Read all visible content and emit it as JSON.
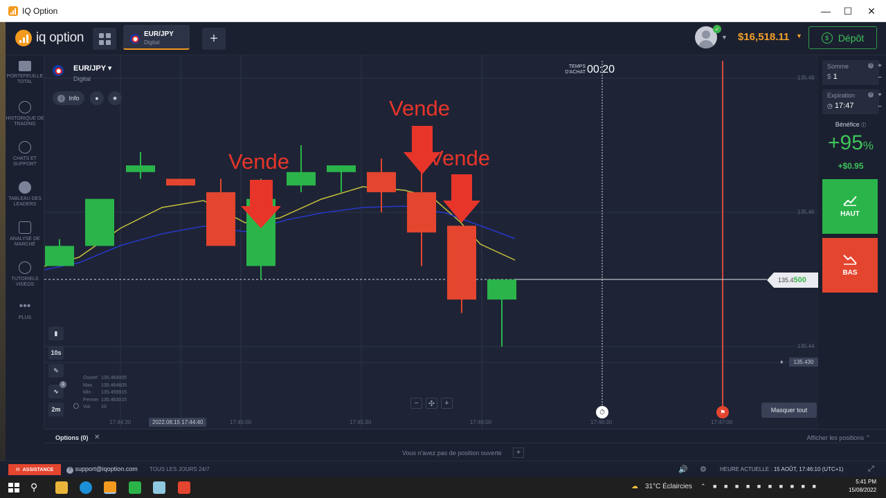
{
  "window": {
    "title": "IQ Option"
  },
  "header": {
    "logo_text": "iq option",
    "asset_tab": {
      "name": "EUR/JPY",
      "type": "Digital"
    },
    "balance": "$16,518.11",
    "deposit_label": "Dépôt"
  },
  "sidebar": {
    "items": [
      {
        "label": "PORTEFEUILLE TOTAL",
        "icon": "briefcase-icon"
      },
      {
        "label": "HISTORIQUE DE TRADING",
        "icon": "history-icon"
      },
      {
        "label": "CHATS ET SUPPORT",
        "icon": "chat-icon"
      },
      {
        "label": "TABLEAU DES LEADERS",
        "icon": "leaderboard-icon"
      },
      {
        "label": "ANALYSE DE MARCHÉ",
        "icon": "market-analysis-icon"
      },
      {
        "label": "TUTORIELS VIDÉOS",
        "icon": "play-icon"
      },
      {
        "label": "PLUS",
        "icon": "more-icon"
      }
    ]
  },
  "chart_header": {
    "asset": "EUR/JPY",
    "type": "Digital",
    "info_label": "Info"
  },
  "timer": {
    "label": "TEMPS D'ACHAT",
    "value": "00:20"
  },
  "annotations": [
    "Vende",
    "Vende",
    "Vende"
  ],
  "tools": {
    "interval": "10s",
    "timeframe": "2m",
    "indicator_count": "1"
  },
  "ohlc": {
    "labels": [
      "Ouvert",
      "Max",
      "Min",
      "Fermer",
      "Vol."
    ],
    "values": [
      "135.464005",
      "135.464605",
      "135.459915",
      "135.463015",
      "10"
    ]
  },
  "price_tag": {
    "prefix": "135.4",
    "suffix": "500"
  },
  "alarm_tag": "135.430",
  "masquer_label": "Masquer tout",
  "right_panel": {
    "amount": {
      "label": "Somme",
      "currency": "$",
      "value": "1"
    },
    "expiration": {
      "label": "Expiration",
      "value": "17:47"
    },
    "benefit_label": "Bénéfice",
    "benefit_percent": "+95",
    "benefit_percent_sign": "%",
    "benefit_amount": "+$0.95",
    "up_label": "HAUT",
    "down_label": "BAS"
  },
  "options_bar": {
    "tab_label": "Options (0)",
    "show_positions": "Afficher les positions",
    "empty_text": "Vous n'avez pas de position ouverte"
  },
  "footer": {
    "assistance": "ASSISTANCE",
    "support_email": "support@iqoption.com",
    "hours": "TOUS LES JOURS 24/7",
    "time_label": "HEURE ACTUELLE :",
    "time_value": "15 AOÛT, 17:46:10 (UTC+1)"
  },
  "taskbar": {
    "weather": "31°C  Éclaircies",
    "time": "5:41 PM",
    "date": "15/08/2022"
  },
  "colors": {
    "accent": "#f39a1e",
    "up": "#2ab44a",
    "down": "#e4452f",
    "annotation": "#e8352a",
    "balance": "#f3a12a"
  },
  "chart_data": {
    "type": "candlestick",
    "x_ticks": [
      "17:44:30",
      "2022.08.15 17:44:40",
      "17:45:00",
      "17:45:30",
      "17:46:00",
      "17:46:30",
      "17:47:00"
    ],
    "y_ticks": [
      "135.48",
      "135.46",
      "135.44"
    ],
    "candles": [
      {
        "open": 135.452,
        "close": 135.455,
        "high": 135.456,
        "low": 135.452,
        "dir": "up"
      },
      {
        "open": 135.455,
        "close": 135.462,
        "high": 135.462,
        "low": 135.455,
        "dir": "up"
      },
      {
        "open": 135.466,
        "close": 135.467,
        "high": 135.469,
        "low": 135.465,
        "dir": "up"
      },
      {
        "open": 135.465,
        "close": 135.464,
        "high": 135.465,
        "low": 135.464,
        "dir": "down"
      },
      {
        "open": 135.463,
        "close": 135.455,
        "high": 135.465,
        "low": 135.455,
        "dir": "down"
      },
      {
        "open": 135.452,
        "close": 135.462,
        "high": 135.465,
        "low": 135.45,
        "dir": "up"
      },
      {
        "open": 135.464,
        "close": 135.466,
        "high": 135.47,
        "low": 135.463,
        "dir": "up"
      },
      {
        "open": 135.466,
        "close": 135.467,
        "high": 135.467,
        "low": 135.463,
        "dir": "up"
      },
      {
        "open": 135.466,
        "close": 135.463,
        "high": 135.468,
        "low": 135.46,
        "dir": "down"
      },
      {
        "open": 135.463,
        "close": 135.457,
        "high": 135.466,
        "low": 135.452,
        "dir": "down"
      },
      {
        "open": 135.458,
        "close": 135.447,
        "high": 135.458,
        "low": 135.445,
        "dir": "down"
      },
      {
        "open": 135.45,
        "close": 135.447,
        "high": 135.45,
        "low": 135.44,
        "dir": "up"
      }
    ],
    "current_price": "135.4500"
  }
}
